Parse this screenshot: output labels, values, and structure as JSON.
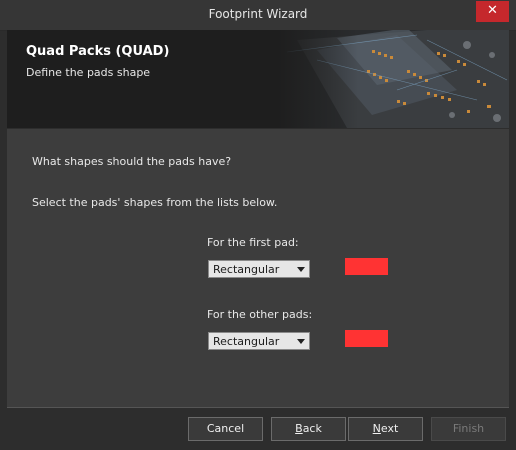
{
  "window": {
    "title": "Footprint Wizard",
    "close_glyph": "✕"
  },
  "header": {
    "title": "Quad Packs (QUAD)",
    "subtitle": "Define the pads shape"
  },
  "main": {
    "question": "What shapes should the pads have?",
    "instruction": "Select the pads' shapes from the lists below.",
    "first_pad": {
      "label": "For the first pad:",
      "shape": "Rectangular",
      "color": "#ff3333"
    },
    "other_pads": {
      "label": "For the other pads:",
      "shape": "Rectangular",
      "color": "#ff3333"
    }
  },
  "footer": {
    "cancel": "Cancel",
    "back_mnemonic": "B",
    "back_rest": "ack",
    "next_mnemonic": "N",
    "next_rest": "ext",
    "finish": "Finish"
  },
  "icons": {
    "close": "close-icon",
    "dropdown": "chevron-down-icon",
    "banner": "pcb-illustration"
  }
}
